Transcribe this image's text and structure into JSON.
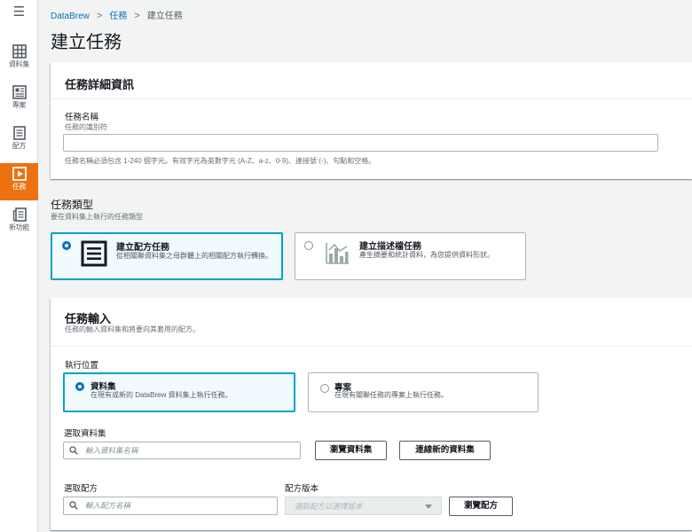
{
  "sidebar": {
    "menu_icon": "☰",
    "items": [
      {
        "label": "資料集",
        "icon": "table-icon"
      },
      {
        "label": "專案",
        "icon": "grid-icon"
      },
      {
        "label": "配方",
        "icon": "list-icon"
      },
      {
        "label": "任務",
        "icon": "play-icon"
      },
      {
        "label": "新功能",
        "icon": "news-icon"
      }
    ],
    "active_index": 3
  },
  "breadcrumb": {
    "items": [
      "DataBrew",
      "任務",
      "建立任務"
    ],
    "separator": ">"
  },
  "page_title": "建立任務",
  "job_details": {
    "header": "任務詳細資訊",
    "name_label": "任務名稱",
    "name_sublabel": "任務的識別符",
    "name_value": "",
    "name_hint": "任務名稱必須包含 1-240 個字元。有效字元為英數字元 (A-Z、a-z、0-9)、連接號 (-)、句點和空格。"
  },
  "job_type": {
    "header": "任務類型",
    "sublabel": "要在資料集上執行的任務類型",
    "options": [
      {
        "title": "建立配方任務",
        "desc": "從相關聯資料集之母群體上的相關配方執行轉換。",
        "selected": true,
        "icon": "recipe-list-icon"
      },
      {
        "title": "建立描述檔任務",
        "desc": "產生摘要和統計資料，為您提供資料形狀。",
        "selected": false,
        "icon": "bar-chart-icon"
      }
    ]
  },
  "job_input": {
    "header": "任務輸入",
    "sublabel": "任務的輸入資料集和將要向其套用的配方。",
    "run_on_label": "執行位置",
    "run_on_options": [
      {
        "title": "資料集",
        "desc": "在現有或新的 DataBrew 資料集上執行任務。",
        "selected": true
      },
      {
        "title": "專案",
        "desc": "在現有關聯任務的專案上執行任務。",
        "selected": false
      }
    ],
    "dataset_label": "選取資料集",
    "dataset_placeholder": "輸入資料集名稱",
    "browse_datasets": "瀏覽資料集",
    "connect_new_dataset": "連線新的資料集",
    "recipe_label": "選取配方",
    "recipe_placeholder": "輸入配方名稱",
    "recipe_version_label": "配方版本",
    "recipe_version_placeholder": "選取配方以選擇版本",
    "browse_recipes": "瀏覽配方"
  },
  "colors": {
    "accent_orange": "#ec7211",
    "link_blue": "#0073bb",
    "selected_border": "#00a1c9"
  }
}
